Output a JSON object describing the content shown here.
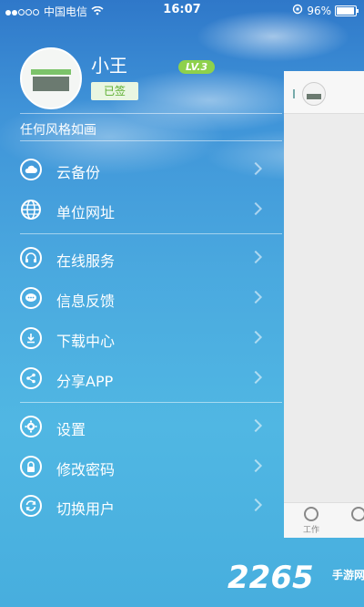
{
  "status_bar": {
    "carrier": "中国电信",
    "time": "16:07",
    "battery": "96%",
    "battery_level": 0.96
  },
  "profile": {
    "name": "小王",
    "level": "LV.3",
    "signed_label": "已签",
    "motto": "任何风格如画"
  },
  "menu": {
    "items": [
      {
        "label": "云备份",
        "icon": "cloud-icon"
      },
      {
        "label": "单位网址",
        "icon": "globe-icon"
      },
      {
        "label": "在线服务",
        "icon": "headset-icon"
      },
      {
        "label": "信息反馈",
        "icon": "chat-icon"
      },
      {
        "label": "下载中心",
        "icon": "download-icon"
      },
      {
        "label": "分享APP",
        "icon": "share-icon"
      },
      {
        "label": "设置",
        "icon": "gear-icon"
      },
      {
        "label": "修改密码",
        "icon": "lock-icon"
      },
      {
        "label": "切换用户",
        "icon": "switch-user-icon"
      }
    ]
  },
  "right_panel": {
    "tabs": [
      {
        "label": "工作"
      },
      {
        "label": ""
      }
    ]
  },
  "watermark": {
    "text": "2265",
    "site": "手游网",
    "url": ""
  }
}
